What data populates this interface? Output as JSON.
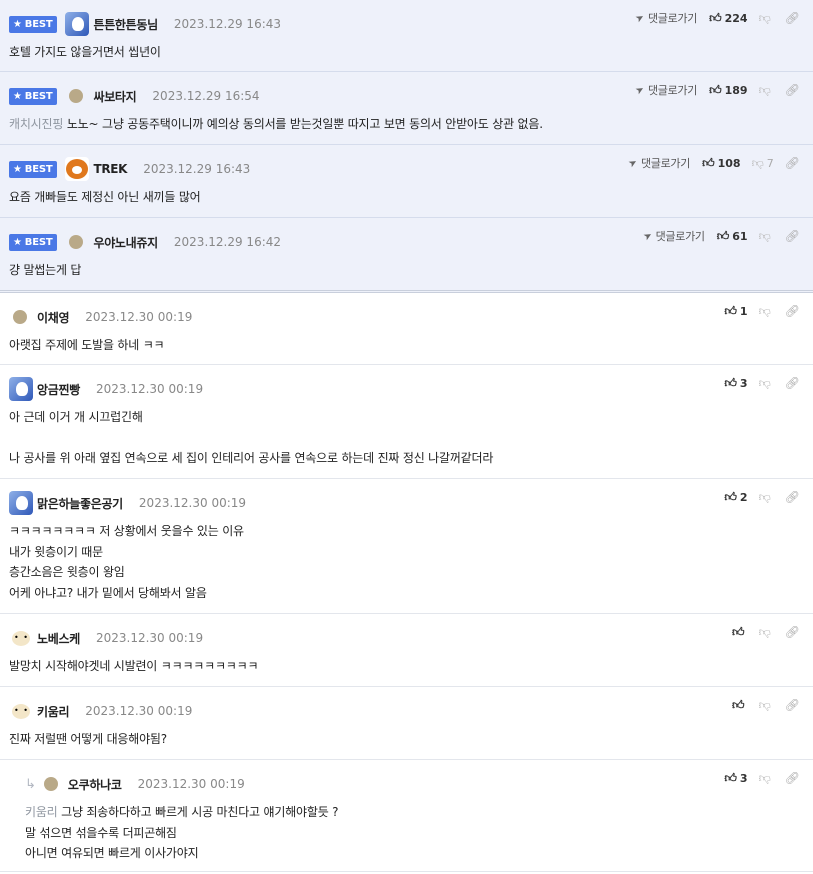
{
  "labels": {
    "best": "BEST",
    "reply": "댓글로가기"
  },
  "comments": [
    {
      "best": true,
      "avatar": "blue",
      "nick": "튼튼한튼동님",
      "date": "2023.12.29 16:43",
      "body": "호텔 가지도 않을거면서 씹년이",
      "up": "224",
      "down": "",
      "showReply": true
    },
    {
      "best": true,
      "avatar": "blank",
      "nick": "싸보타지",
      "date": "2023.12.29 16:54",
      "mention": "캐치시진핑",
      "body": "노노~ 그냥 공동주택이니까 예의상 동의서를 받는것일뿐 따지고 보면 동의서 안받아도 상관 없음.",
      "up": "189",
      "down": "",
      "showReply": true
    },
    {
      "best": true,
      "avatar": "bear",
      "nick": "TREK",
      "date": "2023.12.29 16:43",
      "body": "요즘 개빠들도 제정신 아닌 새끼들 많어",
      "up": "108",
      "down": "7",
      "showReply": true
    },
    {
      "best": true,
      "avatar": "blank",
      "nick": "우야노내쥬지",
      "date": "2023.12.29 16:42",
      "body": "걍 말썹는게 답",
      "up": "61",
      "down": "",
      "showReply": true
    },
    {
      "best": false,
      "avatar": "blank",
      "nick": "이채영",
      "date": "2023.12.30 00:19",
      "body": "아랫집 주제에 도발을 하네 ㅋㅋ",
      "up": "1",
      "down": ""
    },
    {
      "best": false,
      "avatar": "blue",
      "nick": "앙금찐빵",
      "date": "2023.12.30 00:19",
      "body": "아 근데 이거 개 시끄럽긴해\n\n나 공사를 위 아래 옆집 연속으로 세 집이 인테리어 공사를 연속으로 하는데 진짜 정신 나갈꺼같더라",
      "up": "3",
      "down": ""
    },
    {
      "best": false,
      "avatar": "blue",
      "nick": "맑은하늘좋은공기",
      "date": "2023.12.30 00:19",
      "body": "ㅋㅋㅋㅋㅋㅋㅋㅋ 저 상황에서 웃을수 있는 이유\n내가 윗층이기 때문\n층간소음은 윗층이 왕임\n어케 아냐고? 내가 밑에서 당해봐서 알음",
      "up": "2",
      "down": ""
    },
    {
      "best": false,
      "avatar": "dog",
      "nick": "노베스케",
      "date": "2023.12.30 00:19",
      "body": "발망치 시작해야겟네 시발련이 ㅋㅋㅋㅋㅋㅋㅋㅋㅋ",
      "up": "",
      "down": ""
    },
    {
      "best": false,
      "avatar": "dog",
      "nick": "키움리",
      "date": "2023.12.30 00:19",
      "body": "진짜 저럴땐 어떻게 대응해야됨?",
      "up": "",
      "down": ""
    },
    {
      "best": false,
      "reply": true,
      "avatar": "blank",
      "nick": "오쿠하나코",
      "date": "2023.12.30 00:19",
      "mention": "키움리",
      "body": "그냥 죄송하다하고 빠르게 시공 마친다고 얘기해야할듯 ?\n말 섞으면 섞을수록 더피곤해짐\n아니면 여유되면 빠르게 이사가야지",
      "up": "3",
      "down": ""
    }
  ]
}
